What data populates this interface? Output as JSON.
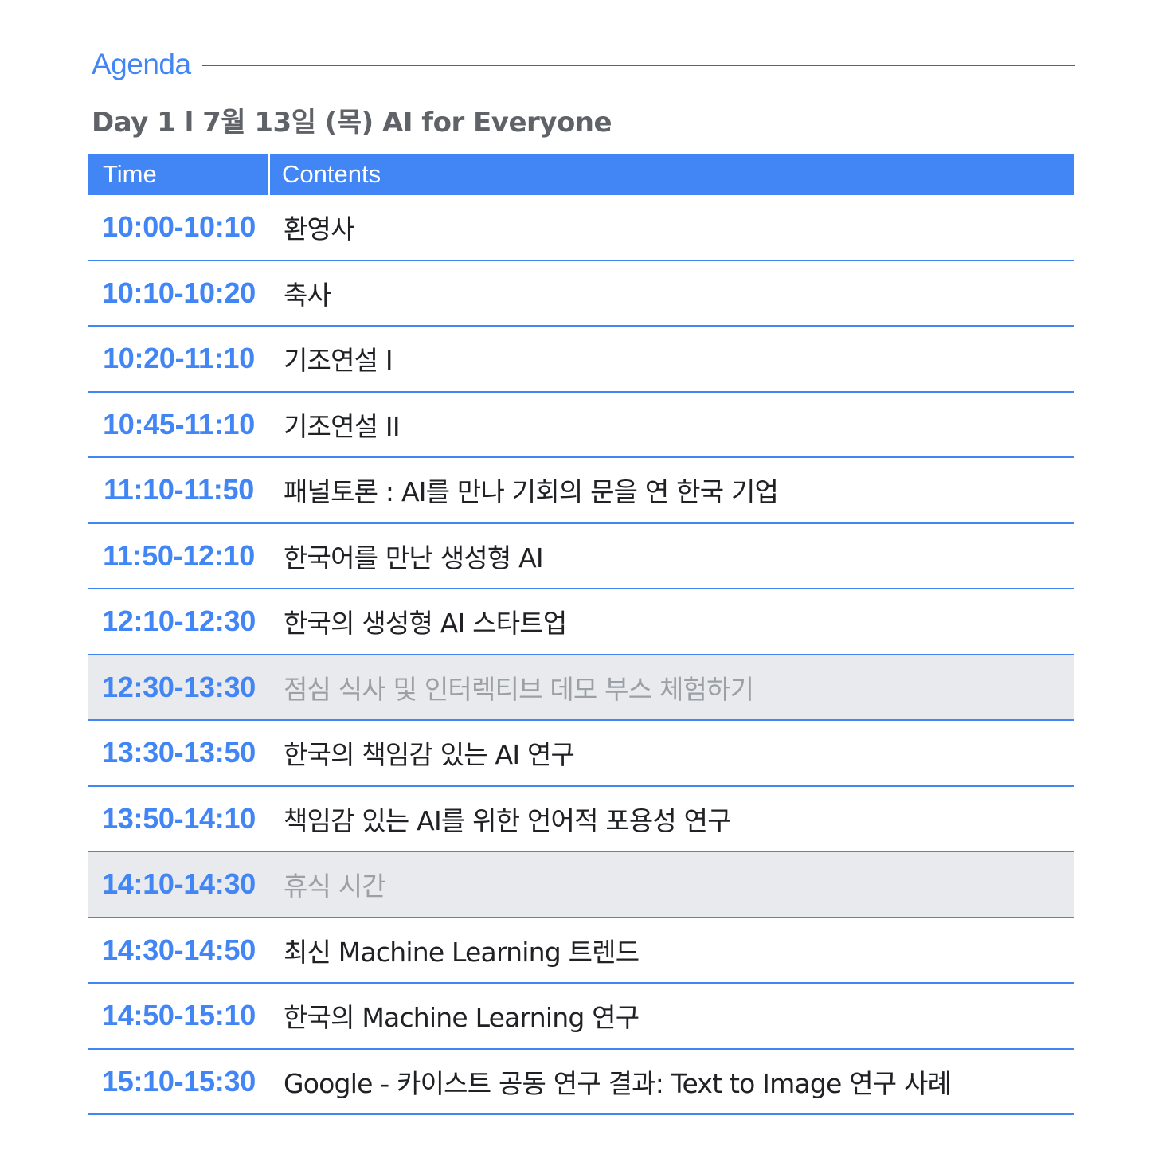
{
  "header": {
    "agenda_label": "Agenda",
    "day_title": "Day 1 l 7월 13일 (목) AI for Everyone"
  },
  "table": {
    "columns": [
      "Time",
      "Contents"
    ],
    "rows": [
      {
        "time": "10:00-10:10",
        "content": "환영사",
        "break": false
      },
      {
        "time": "10:10-10:20",
        "content": "축사",
        "break": false
      },
      {
        "time": "10:20-11:10",
        "content": "기조연설 I",
        "break": false
      },
      {
        "time": "10:45-11:10",
        "content": "기조연설 II",
        "break": false
      },
      {
        "time": "11:10-11:50",
        "content": "패널토론 :  AI를 만나 기회의 문을 연 한국 기업",
        "break": false
      },
      {
        "time": "11:50-12:10",
        "content": "한국어를 만난 생성형 AI",
        "break": false
      },
      {
        "time": "12:10-12:30",
        "content": "한국의 생성형 AI 스타트업",
        "break": false
      },
      {
        "time": "12:30-13:30",
        "content": "점심 식사 및 인터렉티브 데모 부스 체험하기",
        "break": true
      },
      {
        "time": "13:30-13:50",
        "content": "한국의 책임감 있는 AI 연구",
        "break": false
      },
      {
        "time": "13:50-14:10",
        "content": "책임감 있는 AI를 위한 언어적 포용성 연구",
        "break": false
      },
      {
        "time": "14:10-14:30",
        "content": "휴식 시간",
        "break": true
      },
      {
        "time": "14:30-14:50",
        "content": "최신 Machine Learning 트렌드",
        "break": false
      },
      {
        "time": "14:50-15:10",
        "content": "한국의 Machine Learning 연구",
        "break": false
      },
      {
        "time": "15:10-15:30",
        "content": "Google - 카이스트 공동 연구 결과: Text to Image 연구 사례",
        "break": false
      }
    ]
  },
  "colors": {
    "accent": "#4285f4",
    "title_gray": "#5f6368",
    "break_background": "#e8eaed",
    "break_text": "#9aa0a6",
    "text": "#202124"
  }
}
